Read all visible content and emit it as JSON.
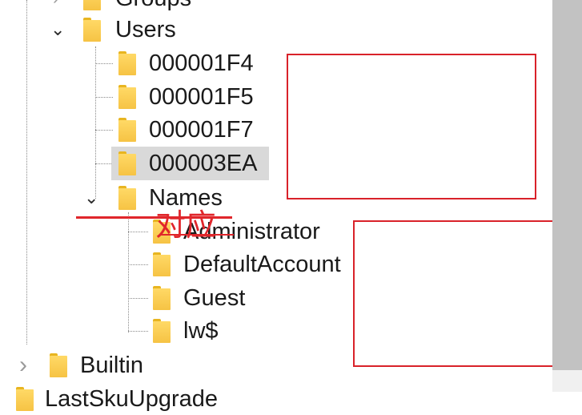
{
  "tree": {
    "groups_label": "Groups",
    "users_label": "Users",
    "users_children": [
      "000001F4",
      "000001F5",
      "000001F7",
      "000003EA"
    ],
    "names_label": "Names",
    "names_children": [
      "Administrator",
      "DefaultAccount",
      "Guest",
      "lw$"
    ],
    "builtin_label": "Builtin",
    "bottom_label": "LastSkuUpgrade"
  },
  "annotation": {
    "text": "对应",
    "color": "#e0262b"
  }
}
